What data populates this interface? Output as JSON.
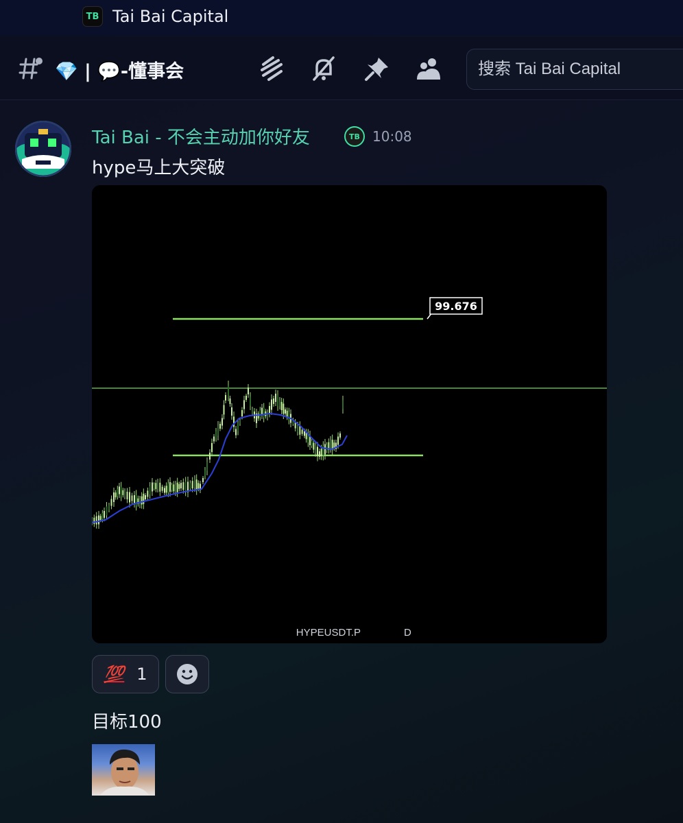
{
  "titlebar": {
    "server_name": "Tai Bai Capital",
    "logo_text": "TB"
  },
  "channel": {
    "hash_icon": "hashtag-icon",
    "name": "💎 | 💬-懂事会",
    "icons": [
      "threads-icon",
      "mute-bell-icon",
      "pin-icon",
      "members-icon"
    ]
  },
  "search": {
    "placeholder": "搜索 Tai Bai Capital"
  },
  "message": {
    "username": "Tai Bai - 不会主动加你好友",
    "timestamp": "10:08",
    "text": "hype马上大突破",
    "role_badge": "TB",
    "username_color": "#57d1b0"
  },
  "chart_data": {
    "type": "line",
    "symbol_label": "HYPEUSDT.P",
    "interval": "D",
    "levels": [
      {
        "name": "target",
        "value": 99.676,
        "label": "99.676",
        "color": "#8ee06a"
      },
      {
        "name": "resistance",
        "color": "#5fb34a"
      },
      {
        "name": "support",
        "color": "#8ee06a"
      }
    ]
  },
  "reactions": [
    {
      "emoji": "💯",
      "count": "1"
    },
    {
      "type": "add-reaction",
      "icon": "smiley-icon"
    }
  ],
  "message2": {
    "text": "目标100"
  }
}
